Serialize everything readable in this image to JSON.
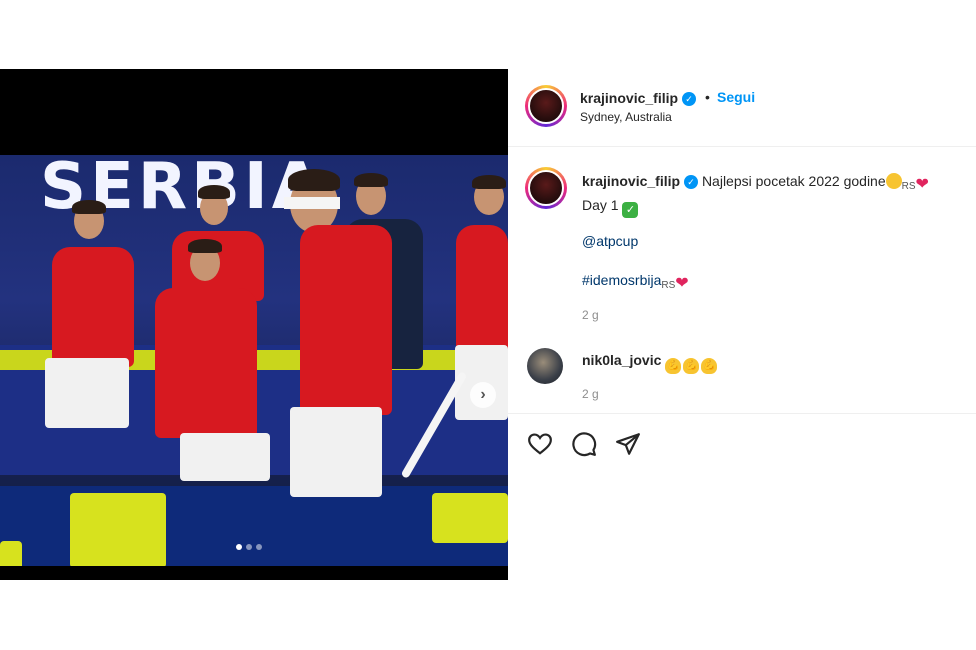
{
  "post": {
    "author": "krajinovic_filip",
    "location": "Sydney, Australia",
    "follow_label": "Segui",
    "separator": "•",
    "caption_text": "Najlepsi pocetak 2022 godine",
    "caption_line2": "Day 1",
    "mention": "@atpcup",
    "hashtag": "#idemosrbija",
    "caption_time": "2 g",
    "flag_text": "RS"
  },
  "media": {
    "banner": "SERBIA",
    "next_icon": "chevron-right-icon",
    "carousel_count": 3,
    "carousel_active": 1
  },
  "comments": [
    {
      "user": "nik0la_jovic",
      "time": "2 g"
    }
  ],
  "actions": [
    "heart-icon",
    "comment-icon",
    "share-icon"
  ],
  "colors": {
    "accent": "#0095f6",
    "link": "#00376b",
    "muted": "#8e8e8e"
  }
}
